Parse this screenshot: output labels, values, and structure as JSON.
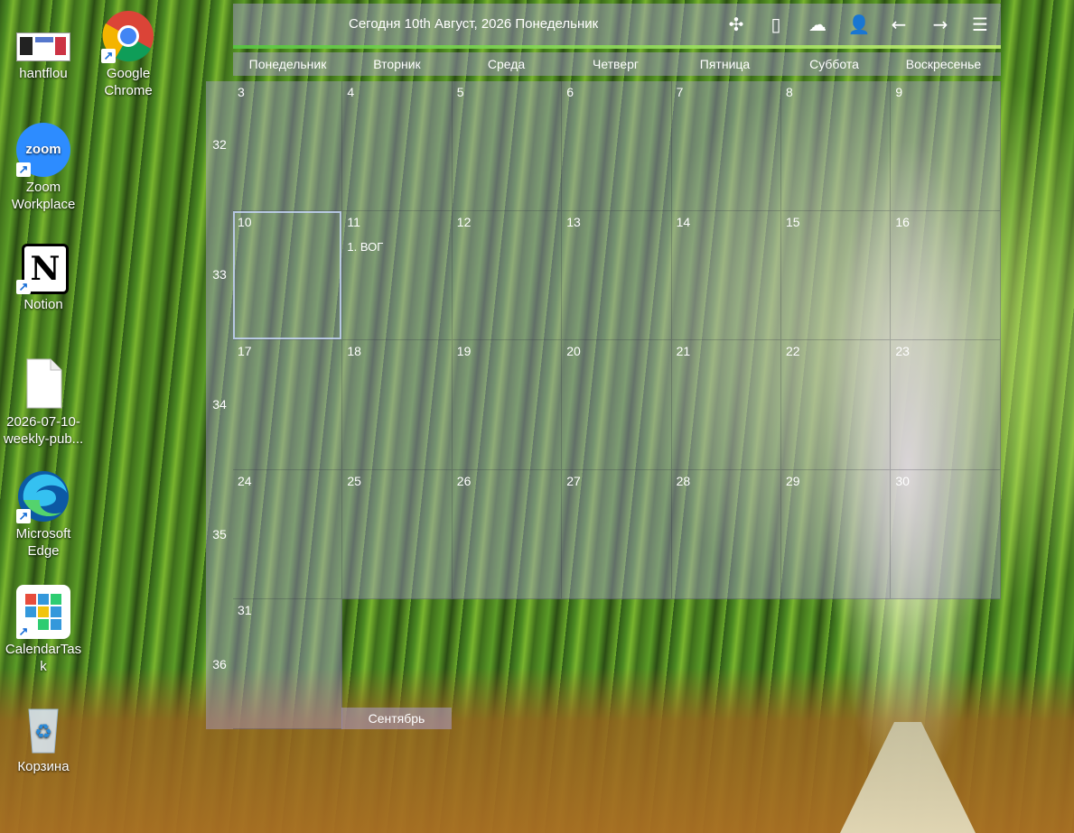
{
  "desktop": {
    "icons": [
      {
        "label": "hantflou",
        "icon": "screenshot-thumbnail-icon"
      },
      {
        "label": "Google Chrome",
        "icon": "chrome-icon"
      },
      {
        "label": "Zoom Workplace",
        "icon": "zoom-icon"
      },
      {
        "label": "Notion",
        "icon": "notion-icon"
      },
      {
        "label": "2026-07-10-weekly-pub...",
        "icon": "document-icon"
      },
      {
        "label": "Microsoft Edge",
        "icon": "edge-icon"
      },
      {
        "label": "CalendarTask",
        "icon": "calendartask-icon"
      },
      {
        "label": "Корзина",
        "icon": "recycle-bin-icon"
      }
    ]
  },
  "calendar": {
    "today_label": "Сегодня 10th Август, 2026 Понедельник",
    "toolbar_icons": [
      "puzzle-icon",
      "phone-icon",
      "cloud-icon",
      "user-icon",
      "arrow-left-icon",
      "arrow-right-icon",
      "menu-icon"
    ],
    "weekdays": [
      "Понедельник",
      "Вторник",
      "Среда",
      "Четверг",
      "Пятница",
      "Суббота",
      "Воскресенье"
    ],
    "weeks": [
      {
        "number": "32",
        "days": [
          "3",
          "4",
          "5",
          "6",
          "7",
          "8",
          "9"
        ]
      },
      {
        "number": "33",
        "days": [
          "10",
          "11",
          "12",
          "13",
          "14",
          "15",
          "16"
        ]
      },
      {
        "number": "34",
        "days": [
          "17",
          "18",
          "19",
          "20",
          "21",
          "22",
          "23"
        ]
      },
      {
        "number": "35",
        "days": [
          "24",
          "25",
          "26",
          "27",
          "28",
          "29",
          "30"
        ]
      },
      {
        "number": "36",
        "days": [
          "31"
        ]
      }
    ],
    "events": [
      {
        "week": 1,
        "day": 1,
        "text": "1. ВОГ"
      }
    ],
    "today_cell": {
      "week": 1,
      "day": 0
    },
    "next_month_label": "Сентябрь",
    "accent_color": "#afa0dc"
  }
}
